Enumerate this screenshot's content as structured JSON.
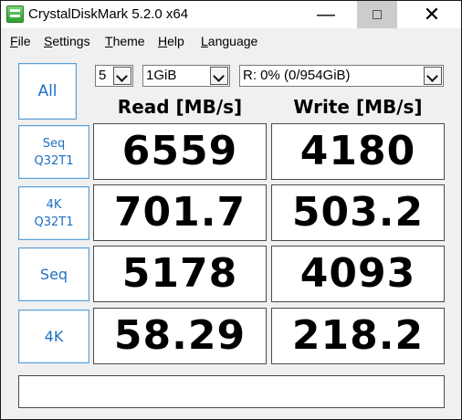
{
  "window": {
    "title": "CrystalDiskMark 5.2.0 x64",
    "controls": {
      "minimize": "—",
      "close": "✕"
    }
  },
  "menu": [
    {
      "key": "F",
      "rest": "ile"
    },
    {
      "key": "S",
      "rest": "ettings"
    },
    {
      "key": "T",
      "rest": "heme"
    },
    {
      "key": "H",
      "rest": "elp"
    },
    {
      "key": "L",
      "rest": "anguage"
    }
  ],
  "controls": {
    "all_button": "All",
    "count_select": "5",
    "size_select": "1GiB",
    "drive_select": "R: 0% (0/954GiB)"
  },
  "headers": {
    "read": "Read [MB/s]",
    "write": "Write [MB/s]"
  },
  "tests": [
    {
      "label_line1": "Seq",
      "label_line2": "Q32T1",
      "read": "6559",
      "write": "4180"
    },
    {
      "label_line1": "4K",
      "label_line2": "Q32T1",
      "read": "701.7",
      "write": "503.2"
    },
    {
      "label_line1": "Seq",
      "label_line2": "",
      "read": "5178",
      "write": "4093"
    },
    {
      "label_line1": "4K",
      "label_line2": "",
      "read": "58.29",
      "write": "218.2"
    }
  ],
  "status_text": "",
  "colors": {
    "tile_text": "#1e6fc4",
    "tile_border": "#5aa0d8",
    "window_bg": "#f0f0f0",
    "value_text": "#000000"
  }
}
